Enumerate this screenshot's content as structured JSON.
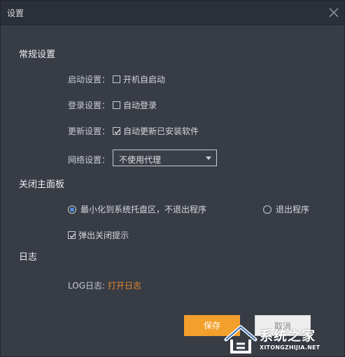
{
  "window": {
    "title": "设置"
  },
  "general": {
    "section_title": "常规设置",
    "startup": {
      "label": "启动设置：",
      "option": "开机自启动",
      "checked": false
    },
    "login": {
      "label": "登录设置：",
      "option": "自动登录",
      "checked": false
    },
    "update": {
      "label": "更新设置：",
      "option": "自动更新已安装软件",
      "checked": true
    },
    "network": {
      "label": "网络设置：",
      "selected": "不使用代理"
    }
  },
  "close_panel": {
    "section_title": "关闭主面板",
    "minimize_option": {
      "label": "最小化到系统托盘区，不退出程序",
      "checked": true
    },
    "exit_option": {
      "label": "退出程序",
      "checked": false
    },
    "popup_prompt": {
      "label": "弹出关闭提示",
      "checked": true
    }
  },
  "log": {
    "section_title": "日志",
    "label": "LOG日志:",
    "open_link": "打开日志"
  },
  "buttons": {
    "save": "保存",
    "cancel": "取消"
  },
  "watermark": {
    "name": "系统之家",
    "url": "XITONGZHIJIA.NET"
  },
  "colors": {
    "accent_orange": "#f2a02c",
    "link_orange": "#e2852e",
    "radio_blue": "#4a90e2",
    "background": "#383c45",
    "titlebar": "#2b2f37"
  },
  "icons": {
    "close": "close-icon",
    "dropdown": "chevron-down-icon",
    "checkmark": "checkmark-icon",
    "watermark_logo": "house-logo-icon"
  }
}
